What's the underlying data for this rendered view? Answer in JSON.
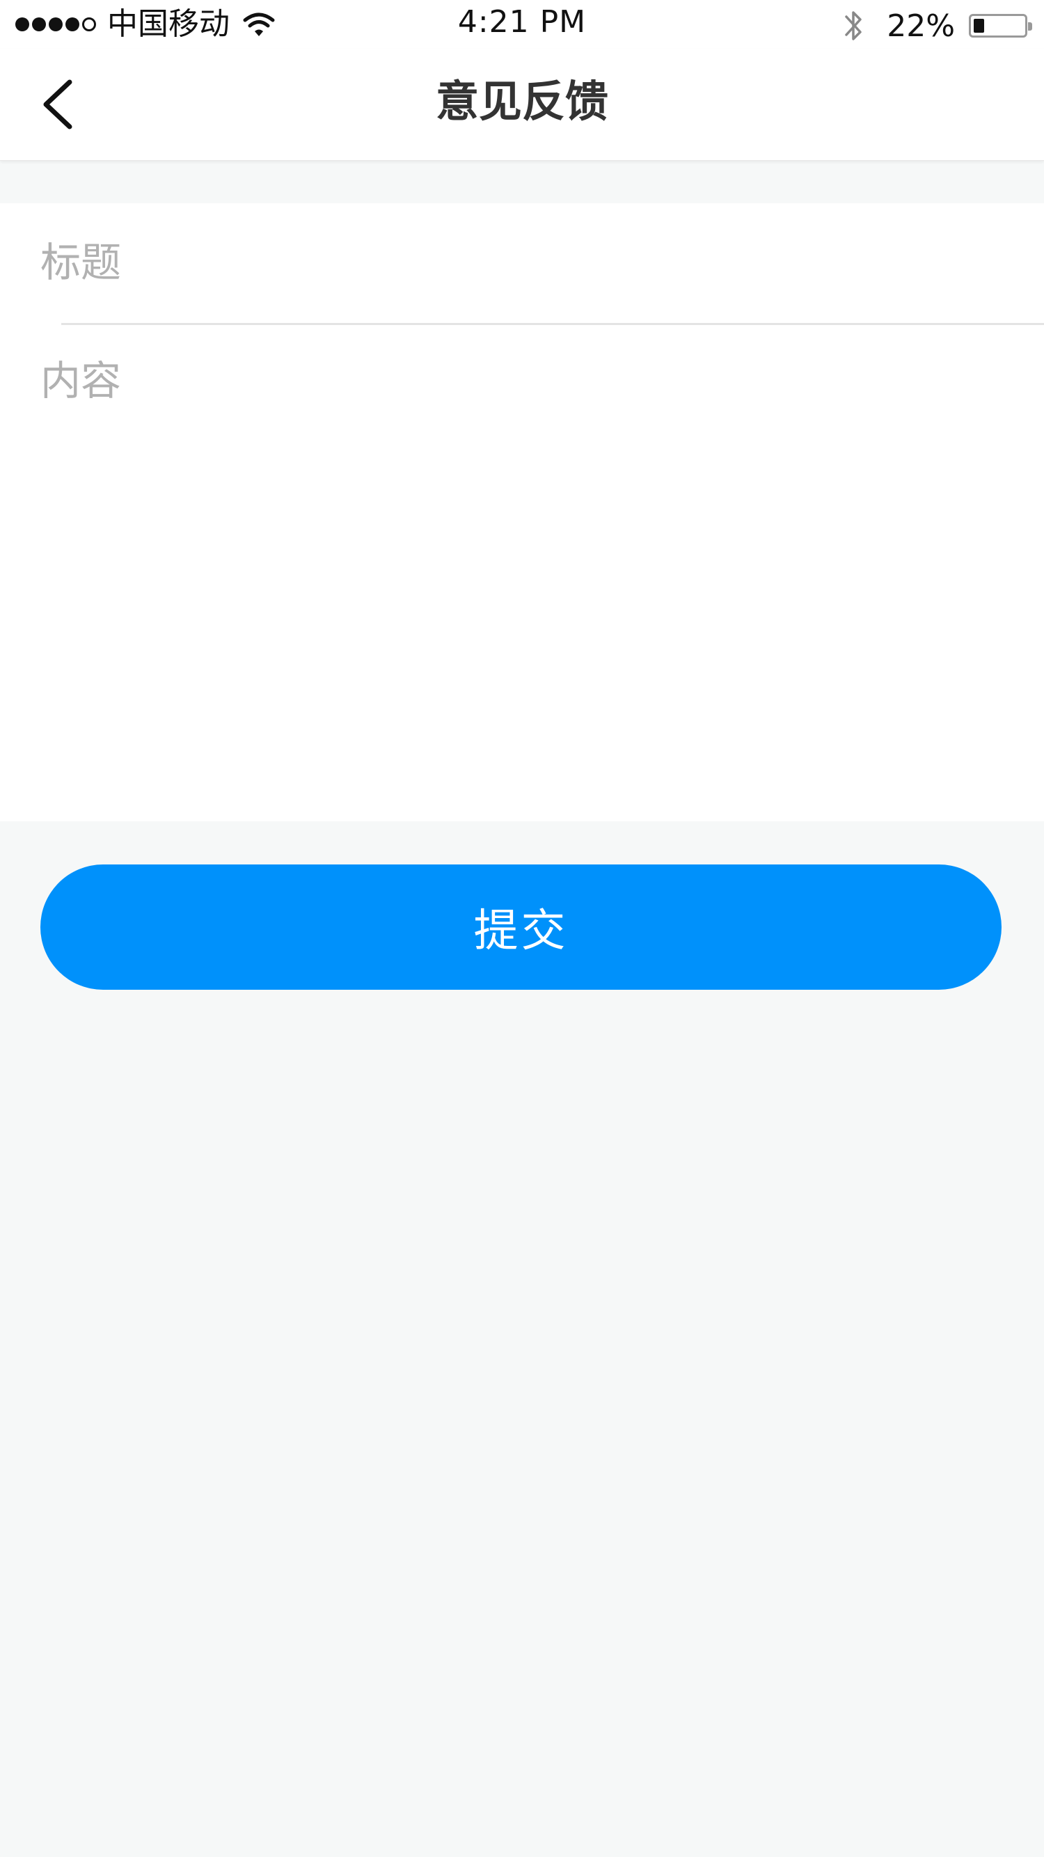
{
  "status_bar": {
    "carrier": "中国移动",
    "time": "4:21 PM",
    "battery_percent": "22%",
    "battery_level": 0.22,
    "signal_filled": 4,
    "signal_total": 5,
    "icons": [
      "wifi-icon",
      "bluetooth-icon",
      "battery-icon"
    ]
  },
  "nav": {
    "title": "意见反馈",
    "back_icon": "chevron-left-icon"
  },
  "form": {
    "title_placeholder": "标题",
    "title_value": "",
    "content_placeholder": "内容",
    "content_value": ""
  },
  "submit": {
    "label": "提交"
  },
  "colors": {
    "accent": "#0091fb",
    "background": "#f6f8f8",
    "placeholder": "#b1b1b1",
    "title_text": "#333333"
  }
}
